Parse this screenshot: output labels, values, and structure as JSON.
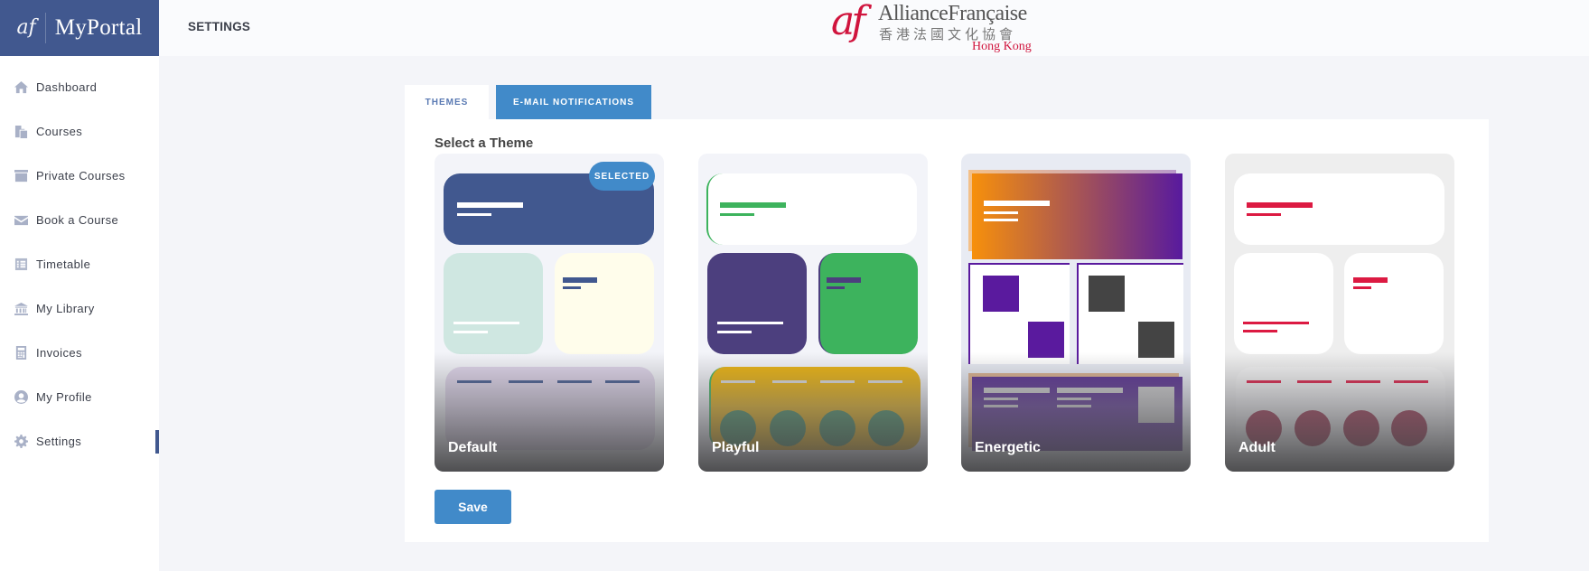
{
  "sidebar": {
    "brand_mark": "af",
    "brand_name": "MyPortal",
    "items": [
      {
        "label": "Dashboard",
        "icon": "home-icon",
        "active": false
      },
      {
        "label": "Courses",
        "icon": "copy-icon",
        "active": false
      },
      {
        "label": "Private Courses",
        "icon": "archive-icon",
        "active": false
      },
      {
        "label": "Book a Course",
        "icon": "envelope-icon",
        "active": false
      },
      {
        "label": "Timetable",
        "icon": "list-icon",
        "active": false
      },
      {
        "label": "My Library",
        "icon": "institution-icon",
        "active": false
      },
      {
        "label": "Invoices",
        "icon": "calculator-icon",
        "active": false
      },
      {
        "label": "My Profile",
        "icon": "user-circle-icon",
        "active": false
      },
      {
        "label": "Settings",
        "icon": "gear-icon",
        "active": true
      }
    ]
  },
  "header": {
    "page_title": "SETTINGS",
    "logo": {
      "mark": "af",
      "line1": "AllianceFrançaise",
      "line2": "香港法國文化協會",
      "line3": "Hong Kong"
    }
  },
  "tabs": [
    {
      "label": "THEMES",
      "active": true
    },
    {
      "label": "E-MAIL NOTIFICATIONS",
      "active": false
    }
  ],
  "themes_panel": {
    "title": "Select a Theme",
    "selected_badge": "SELECTED",
    "themes": [
      {
        "name": "Default",
        "selected": true,
        "colors": {
          "bg": "#f3f4f9",
          "hero": "#41588f",
          "card_left": "#cfe7e1",
          "card_right": "#fffdeb",
          "accent": "#41588f",
          "strip": "#ddd3e8"
        }
      },
      {
        "name": "Playful",
        "selected": false,
        "colors": {
          "bg": "#f3f4f9",
          "hero": "#ffffff",
          "card_left": "#4c3f7e",
          "card_right": "#3db35d",
          "accent": "#3db35d",
          "strip": "#e9b10b",
          "circle": "#3e8a58"
        }
      },
      {
        "name": "Energetic",
        "selected": false,
        "colors": {
          "bg": "#e8ebf3",
          "gradient_start": "#f7900b",
          "gradient_end": "#581a9e",
          "square_left": "#5a1a9e",
          "square_right": "#444444",
          "strip": "#552b8e"
        }
      },
      {
        "name": "Adult",
        "selected": false,
        "colors": {
          "bg": "#eeeeee",
          "hero": "#ffffff",
          "accent": "#dc1a42",
          "circle": "#9a2a45"
        }
      }
    ],
    "save_label": "Save"
  },
  "colors": {
    "brand": "#41588f",
    "primary": "#418ac9",
    "page_bg": "#f4f5f9",
    "logo_red": "#d0143d"
  }
}
